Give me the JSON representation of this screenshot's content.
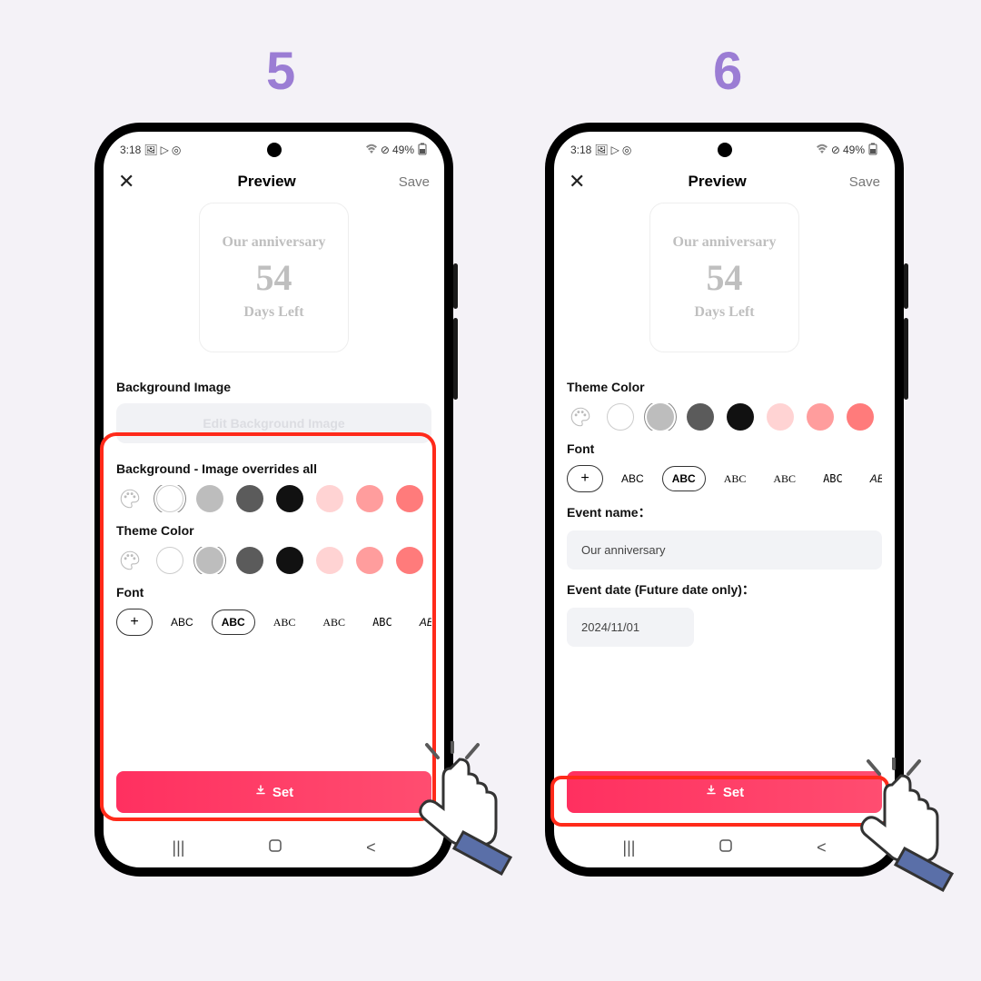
{
  "steps": {
    "s5": "5",
    "s6": "6"
  },
  "statusbar": {
    "time": "3:18",
    "battery": "49%"
  },
  "topbar": {
    "title": "Preview",
    "save": "Save"
  },
  "preview": {
    "title": "Our anniversary",
    "count": "54",
    "unit": "Days Left"
  },
  "screen5": {
    "bg_image_label": "Background Image",
    "edit_bg": "Edit Background Image",
    "bg_override_label": "Background - Image overrides all",
    "theme_label": "Theme Color",
    "font_label": "Font",
    "font_samples": [
      "ABC",
      "ABC",
      "ABC",
      "ABC",
      "ABC",
      "ABC"
    ]
  },
  "screen6": {
    "theme_label": "Theme Color",
    "font_label": "Font",
    "font_samples": [
      "ABC",
      "ABC",
      "ABC",
      "ABC",
      "ABC",
      "ABC"
    ],
    "event_name_label": "Event name：",
    "event_name_value": "Our anniversary",
    "event_date_label": "Event date (Future date only)：",
    "event_date_value": "2024/11/01"
  },
  "set_button": "Set"
}
